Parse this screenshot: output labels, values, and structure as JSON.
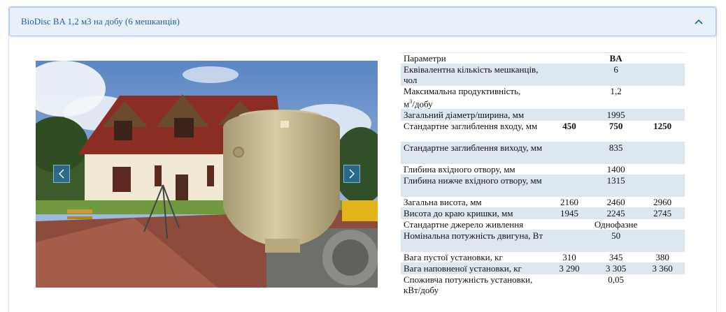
{
  "panel": {
    "title": "BioDisc BA 1,2 м3 на добу (6 мешканців)",
    "chevron_icon": "chevron-up-icon",
    "accent_color": "#1f5fa8",
    "header_bg": "#e8f1fb"
  },
  "carousel": {
    "prev_icon": "chevron-left-icon",
    "next_icon": "chevron-right-icon"
  },
  "table": {
    "header": {
      "param": "Параметри",
      "ba": "BA"
    },
    "rows": [
      {
        "name": "Еквівалентна кількість мешканців, чол",
        "v1": "",
        "v2": "6",
        "v3": ""
      },
      {
        "name": "Максимальна продуктивність,",
        "sup_prefix": "м",
        "sup": "3",
        "name_suffix": "/добу",
        "v1": "",
        "v2": "1,2",
        "v3": ""
      },
      {
        "name": "Загальний діаметр/ширина, мм",
        "v1": "",
        "v2": "1995",
        "v3": ""
      },
      {
        "name": "Стандартне заглиблення входу, мм",
        "v1": "450",
        "v2": "750",
        "v3": "1250"
      },
      {
        "name": "Стандартне заглиблення виходу, мм",
        "v1": "",
        "v2": "835",
        "v3": ""
      },
      {
        "name": "Глибина вхідного отвору, мм",
        "v1": "",
        "v2": "1400",
        "v3": ""
      },
      {
        "name": "Глибина нижче вхідного отвору, мм",
        "v1": "",
        "v2": "1315",
        "v3": ""
      },
      {
        "name": "Загальна висота, мм",
        "v1": "2160",
        "v2": "2460",
        "v3": "2960"
      },
      {
        "name": "Висота до краю кришки, мм",
        "v1": "1945",
        "v2": "2245",
        "v3": "2745"
      },
      {
        "name": "Стандартне джерело живлення",
        "v1": "",
        "v2": "Однофазне",
        "v3": ""
      },
      {
        "name": "Номінальна потужність двигуна, Вт",
        "v1": "",
        "v2": "50",
        "v3": ""
      },
      {
        "name": "Вага пустої установки, кг",
        "v1": "310",
        "v2": "345",
        "v3": "380"
      },
      {
        "name": "Вага наповненої установки, кг",
        "v1": "3 290",
        "v2": "3 305",
        "v3": "3 360"
      },
      {
        "name": "Споживча потужність установки, кВт/добу",
        "v1": "",
        "v2": "0,05",
        "v3": ""
      }
    ]
  }
}
